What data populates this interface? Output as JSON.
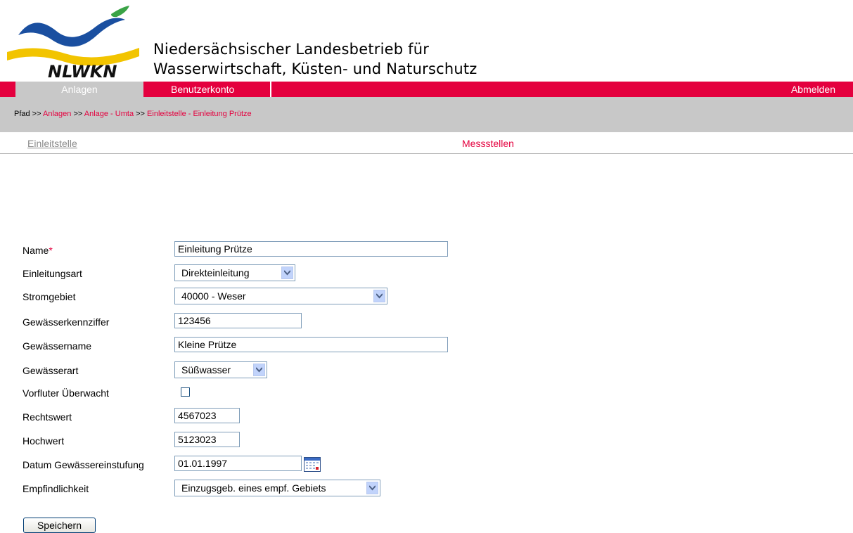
{
  "organization": {
    "logo_text": "NLWKN",
    "name_line1": "Niedersächsischer Landesbetrieb für",
    "name_line2": "Wasserwirtschaft, Küsten- und Naturschutz"
  },
  "navbar": {
    "tabs": [
      "Anlagen",
      "Benutzerkonto"
    ],
    "active_tab": "Anlagen",
    "logout": "Abmelden"
  },
  "breadcrumb": {
    "prefix": "Pfad >>",
    "items": [
      "Anlagen",
      "Anlage - Umta",
      "Einleitstelle - Einleitung Prütze"
    ],
    "separator": ">>"
  },
  "subtabs": {
    "current": "Einleitstelle",
    "other": "Messstellen"
  },
  "form": {
    "name": {
      "label": "Name",
      "required_mark": "*",
      "value": "Einleitung Prütze"
    },
    "einleitungsart": {
      "label": "Einleitungsart",
      "value": "Direkteinleitung"
    },
    "stromgebiet": {
      "label": "Stromgebiet",
      "value": "40000 - Weser"
    },
    "gewaesserkennziffer": {
      "label": "Gewässerkennziffer",
      "value": "123456"
    },
    "gewaessername": {
      "label": "Gewässername",
      "value": "Kleine Prütze"
    },
    "gewaesserart": {
      "label": "Gewässerart",
      "value": "Süßwasser"
    },
    "vorfluter": {
      "label": "Vorfluter Überwacht",
      "checked": false
    },
    "rechtswert": {
      "label": "Rechtswert",
      "value": "4567023"
    },
    "hochwert": {
      "label": "Hochwert",
      "value": "5123023"
    },
    "datum": {
      "label": "Datum Gewässereinstufung",
      "value": "01.01.1997"
    },
    "empfindlichkeit": {
      "label": "Empfindlichkeit",
      "value": "Einzugsgeb. eines empf. Gebiets"
    },
    "save_label": "Speichern"
  },
  "colors": {
    "accent": "#e4003e",
    "nav_gray": "#c8c8c8",
    "logo_blue": "#1a4fa0",
    "logo_yellow": "#f2c400",
    "logo_green": "#3aa346"
  }
}
